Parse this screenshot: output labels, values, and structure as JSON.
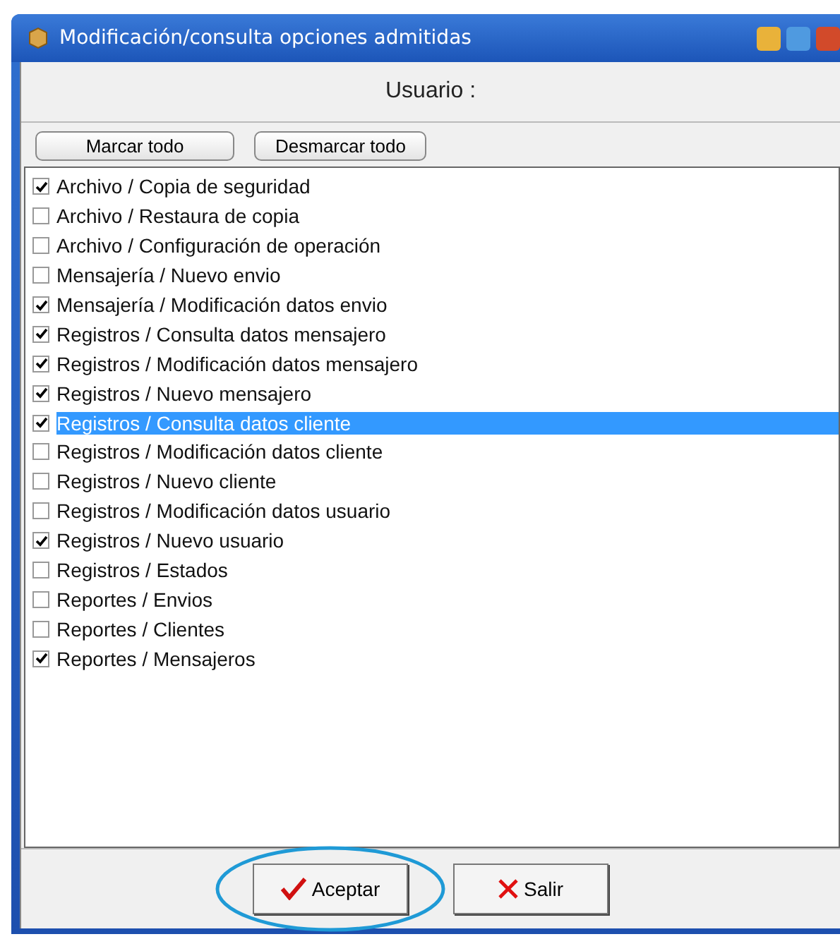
{
  "window": {
    "title": "Modificación/consulta opciones admitidas"
  },
  "header": {
    "label": "Usuario :"
  },
  "toolbar": {
    "buttons": [
      "Marcar todo",
      "Desmarcar todo"
    ]
  },
  "options": [
    {
      "label": "Archivo / Copia de seguridad",
      "checked": true,
      "selected": false
    },
    {
      "label": "Archivo / Restaura de copia",
      "checked": false,
      "selected": false
    },
    {
      "label": "Archivo / Configuración de operación",
      "checked": false,
      "selected": false
    },
    {
      "label": "Mensajería / Nuevo envio",
      "checked": false,
      "selected": false
    },
    {
      "label": "Mensajería / Modificación datos envio",
      "checked": true,
      "selected": false
    },
    {
      "label": "Registros / Consulta datos mensajero",
      "checked": true,
      "selected": false
    },
    {
      "label": "Registros / Modificación datos mensajero",
      "checked": true,
      "selected": false
    },
    {
      "label": "Registros / Nuevo mensajero",
      "checked": true,
      "selected": false
    },
    {
      "label": "Registros / Consulta datos cliente",
      "checked": true,
      "selected": true
    },
    {
      "label": "Registros / Modificación datos cliente",
      "checked": false,
      "selected": false
    },
    {
      "label": "Registros / Nuevo cliente",
      "checked": false,
      "selected": false
    },
    {
      "label": "Registros / Modificación datos usuario",
      "checked": false,
      "selected": false
    },
    {
      "label": "Registros / Nuevo usuario",
      "checked": true,
      "selected": false
    },
    {
      "label": "Registros / Estados",
      "checked": false,
      "selected": false
    },
    {
      "label": "Reportes / Envios",
      "checked": false,
      "selected": false
    },
    {
      "label": "Reportes / Clientes",
      "checked": false,
      "selected": false
    },
    {
      "label": "Reportes / Mensajeros",
      "checked": true,
      "selected": false
    }
  ],
  "footer": {
    "buttons": [
      {
        "label": "Aceptar",
        "kind": "accept",
        "highlighted": true
      },
      {
        "label": "Salir",
        "kind": "exit",
        "highlighted": false
      }
    ]
  }
}
